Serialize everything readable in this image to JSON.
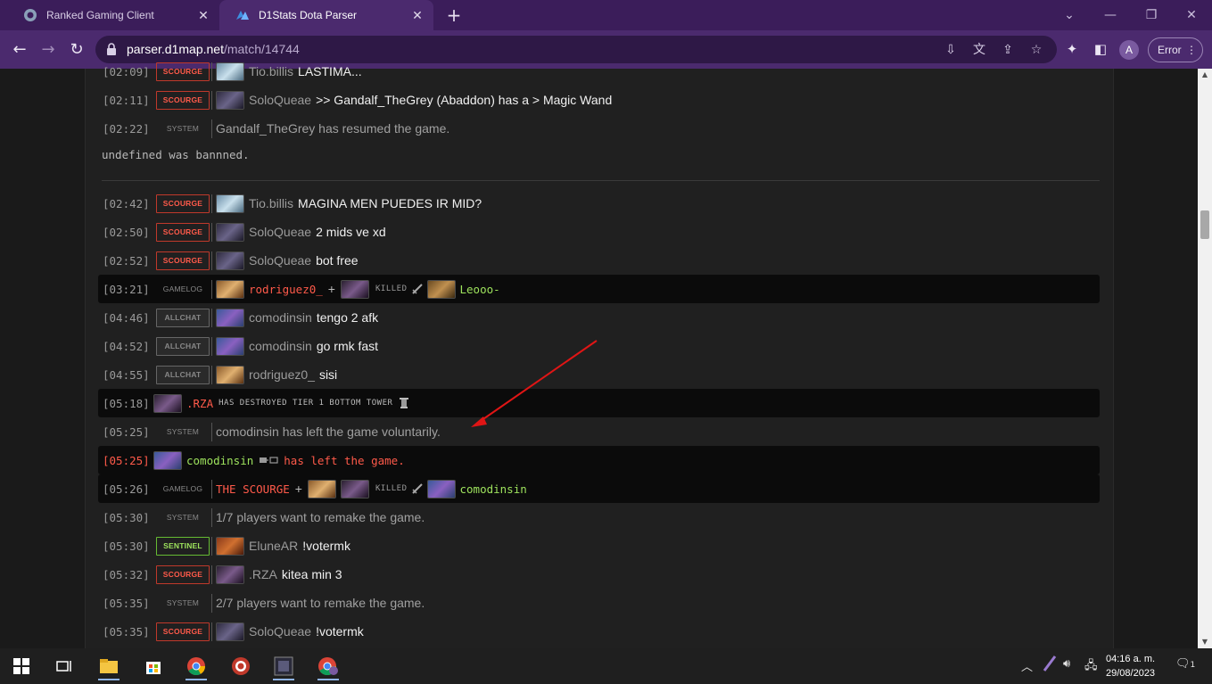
{
  "browser": {
    "tabs": [
      {
        "title": "Ranked Gaming Client",
        "active": false
      },
      {
        "title": "D1Stats Dota Parser",
        "active": true
      }
    ],
    "url_host": "parser.d1map.net",
    "url_path": "/match/14744",
    "error_label": "Error",
    "profile_initial": "A"
  },
  "chat": {
    "top_partial": {
      "time": "[02:09]",
      "badge": "SCOURGE",
      "player": "Tio.billis",
      "text": "LASTIMA..."
    },
    "row_0211": {
      "time": "[02:11]",
      "badge": "SCOURGE",
      "player": "SoloQueae",
      "text": ">> Gandalf_TheGrey (Abaddon) has a > Magic Wand"
    },
    "row_0222": {
      "time": "[02:22]",
      "badge": "SYSTEM",
      "text": "Gandalf_TheGrey has resumed the game."
    },
    "banned_text": "undefined was bannned.",
    "row_0242": {
      "time": "[02:42]",
      "badge": "SCOURGE",
      "player": "Tio.billis",
      "text": "MAGINA MEN PUEDES IR MID?"
    },
    "row_0250": {
      "time": "[02:50]",
      "badge": "SCOURGE",
      "player": "SoloQueae",
      "text": "2 mids ve xd"
    },
    "row_0252": {
      "time": "[02:52]",
      "badge": "SCOURGE",
      "player": "SoloQueae",
      "text": "bot free"
    },
    "row_0321": {
      "time": "[03:21]",
      "badge": "GAMELOG",
      "killer": "rodriguez0_",
      "plus": "+",
      "killed": "KILLED",
      "victim": "Leooo-"
    },
    "row_0446": {
      "time": "[04:46]",
      "badge": "ALLCHAT",
      "player": "comodinsin",
      "text": "tengo 2 afk"
    },
    "row_0452": {
      "time": "[04:52]",
      "badge": "ALLCHAT",
      "player": "comodinsin",
      "text": "go rmk fast"
    },
    "row_0455": {
      "time": "[04:55]",
      "badge": "ALLCHAT",
      "player": "rodriguez0_",
      "text": "sisi"
    },
    "row_0518": {
      "time": "[05:18]",
      "player": ".RZA",
      "text": "HAS DESTROYED TIER 1 BOTTOM TOWER"
    },
    "row_0525a": {
      "time": "[05:25]",
      "badge": "SYSTEM",
      "text": "comodinsin has left the game voluntarily."
    },
    "row_0525b": {
      "time": "[05:25]",
      "player": "comodinsin",
      "text": "has left the game."
    },
    "row_0526": {
      "time": "[05:26]",
      "badge": "GAMELOG",
      "killer": "THE SCOURGE",
      "plus": "+",
      "killed": "KILLED",
      "victim": "comodinsin"
    },
    "row_0530a": {
      "time": "[05:30]",
      "badge": "SYSTEM",
      "text": "1/7 players want to remake the game."
    },
    "row_0530b": {
      "time": "[05:30]",
      "badge": "SENTINEL",
      "player": "EluneAR",
      "text": "!votermk"
    },
    "row_0532": {
      "time": "[05:32]",
      "badge": "SCOURGE",
      "player": ".RZA",
      "text": "kitea min 3"
    },
    "row_0535a": {
      "time": "[05:35]",
      "badge": "SYSTEM",
      "text": "2/7 players want to remake the game."
    },
    "row_0535b": {
      "time": "[05:35]",
      "badge": "SCOURGE",
      "player": "SoloQueae",
      "text": "!votermk"
    }
  },
  "taskbar": {
    "time": "04:16 a. m.",
    "date": "29/08/2023",
    "notification_count": "1"
  },
  "colors": {
    "scourge": "#ff5a4a",
    "sentinel": "#9ee35d",
    "chrome_purple": "#4b2a6e",
    "annotation_arrow": "#e01515"
  }
}
